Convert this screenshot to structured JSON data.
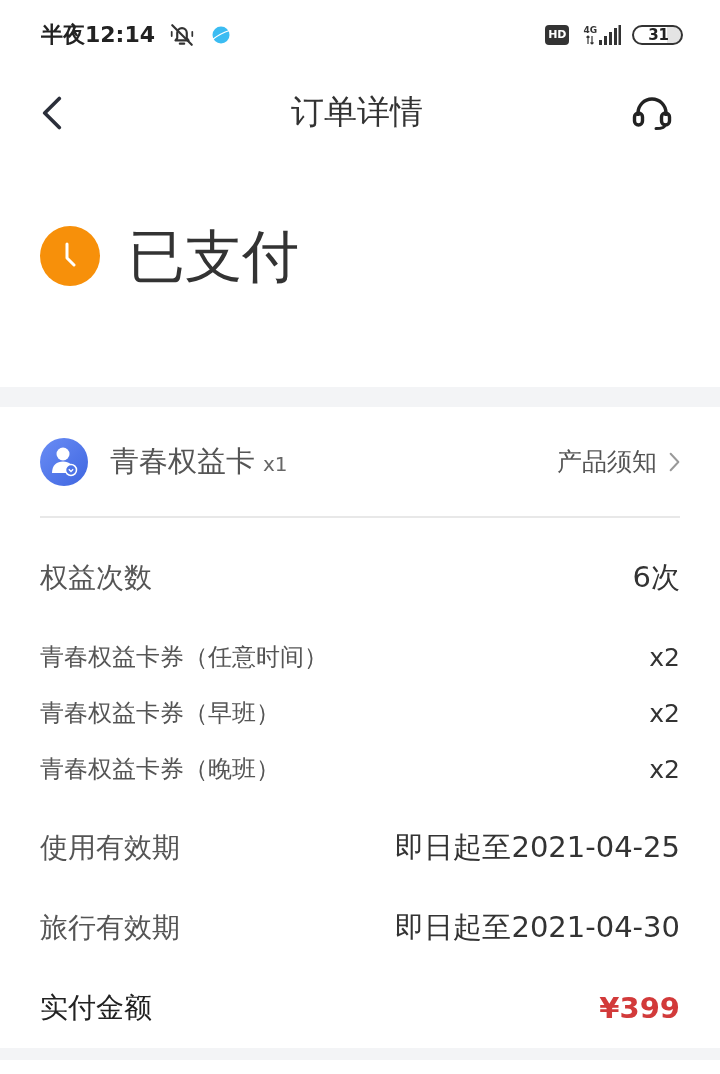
{
  "status_bar": {
    "time": "半夜12:14",
    "hd_badge": "HD",
    "network": "4G",
    "battery": "31"
  },
  "header": {
    "title": "订单详情"
  },
  "order_status": {
    "label": "已支付"
  },
  "product": {
    "name": "青春权益卡",
    "quantity": "x1",
    "notice_link": "产品须知"
  },
  "details": [
    {
      "kind": "main",
      "label": "权益次数",
      "value": "6次"
    },
    {
      "kind": "sub",
      "label": "青春权益卡券（任意时间）",
      "value": "x2"
    },
    {
      "kind": "sub",
      "label": "青春权益卡券（早班）",
      "value": "x2"
    },
    {
      "kind": "sub",
      "label": "青春权益卡券（晚班）",
      "value": "x2"
    },
    {
      "kind": "main",
      "label": "使用有效期",
      "value": "即日起至2021-04-25"
    },
    {
      "kind": "main",
      "label": "旅行有效期",
      "value": "即日起至2021-04-30"
    },
    {
      "kind": "total",
      "label": "实付金额",
      "value": "¥399"
    }
  ]
}
